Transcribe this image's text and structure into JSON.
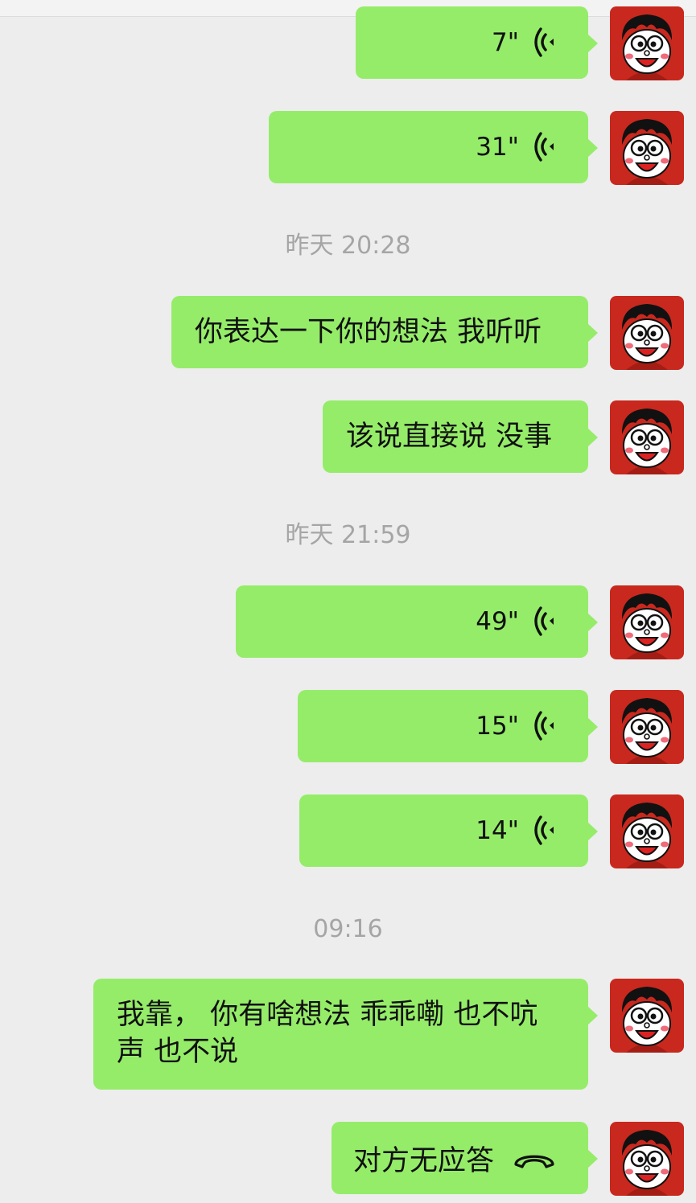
{
  "colors": {
    "background": "#ededed",
    "bubble": "#95ec69",
    "timestamp": "#a5a5a5",
    "avatar_bg": "#c8281e"
  },
  "timestamps": [
    "昨天 20:28",
    "昨天 21:59",
    "09:16"
  ],
  "messages": [
    {
      "type": "voice",
      "duration": "7\"",
      "icon": "voice-wave-icon"
    },
    {
      "type": "voice",
      "duration": "31\"",
      "icon": "voice-wave-icon"
    },
    {
      "type": "text",
      "text": "你表达一下你的想法 我听听"
    },
    {
      "type": "text",
      "text": "该说直接说 没事"
    },
    {
      "type": "voice",
      "duration": "49\"",
      "icon": "voice-wave-icon"
    },
    {
      "type": "voice",
      "duration": "15\"",
      "icon": "voice-wave-icon"
    },
    {
      "type": "voice",
      "duration": "14\"",
      "icon": "voice-wave-icon"
    },
    {
      "type": "text",
      "text": "我靠， 你有啥想法 乖乖嘞 也不吭声 也不说"
    },
    {
      "type": "call",
      "text": "对方无应答",
      "icon": "phone-hangup-icon"
    }
  ]
}
